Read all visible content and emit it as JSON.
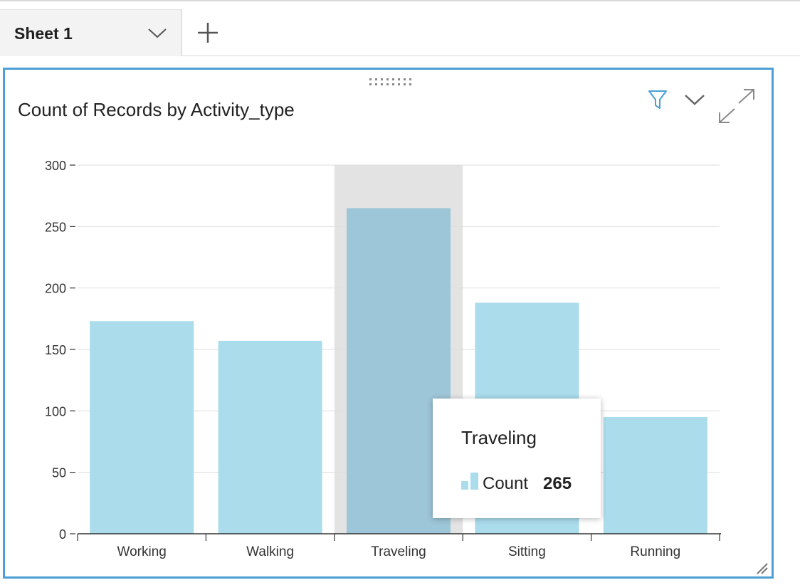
{
  "tabs": {
    "sheet_label": "Sheet 1",
    "chevron_icon": "chevron-down-icon",
    "add_icon": "plus-icon"
  },
  "visual": {
    "title": "Count of Records by Activity_type",
    "toolbar_icons": [
      "filter-icon",
      "chevron-down-icon",
      "expand-icon"
    ],
    "accent_color": "#4b9fd6"
  },
  "tooltip": {
    "title": "Traveling",
    "field_label": "Count",
    "value": "265"
  },
  "chart_data": {
    "type": "bar",
    "title": "Count of Records by Activity_type",
    "categories": [
      "Working",
      "Walking",
      "Traveling",
      "Sitting",
      "Running"
    ],
    "values": [
      173,
      157,
      265,
      188,
      95
    ],
    "ylim": [
      0,
      300
    ],
    "yticks": [
      0,
      50,
      100,
      150,
      200,
      250,
      300
    ],
    "highlighted_category": "Traveling",
    "grid": true,
    "bar_color": "#abdcec",
    "highlight_bar_color": "#9dc6d8",
    "highlight_band_color": "#e3e3e3"
  }
}
